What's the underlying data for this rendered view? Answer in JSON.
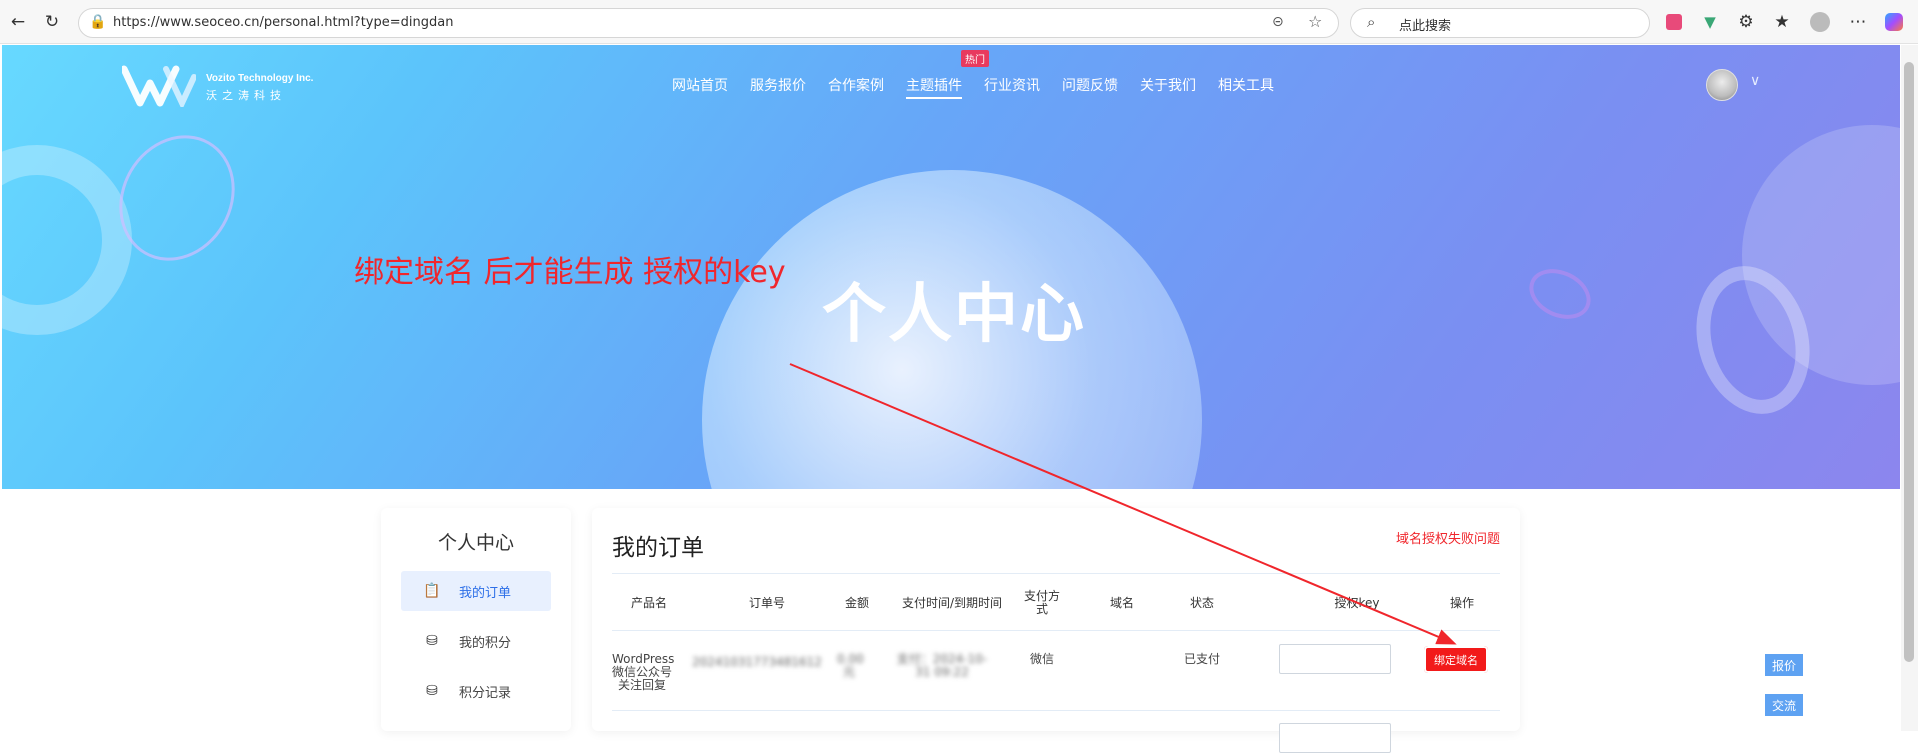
{
  "browser": {
    "url": "https://www.seoceo.cn/personal.html?type=dingdan",
    "search_placeholder": "点此搜索"
  },
  "site": {
    "logo_line1": "Vozito Technology Inc.",
    "logo_line2": "沃之涛科技",
    "nav": [
      {
        "label": "网站首页"
      },
      {
        "label": "服务报价"
      },
      {
        "label": "合作案例"
      },
      {
        "label": "主题插件",
        "active": true
      },
      {
        "label": "行业资讯"
      },
      {
        "label": "问题反馈"
      },
      {
        "label": "关于我们"
      },
      {
        "label": "相关工具"
      }
    ],
    "hot_badge": "热门",
    "hero_title": "个人中心",
    "annotation": "绑定域名  后才能生成 授权的key"
  },
  "sidebar": {
    "title": "个人中心",
    "items": [
      {
        "label": "我的订单",
        "active": true
      },
      {
        "label": "我的积分"
      },
      {
        "label": "积分记录"
      }
    ]
  },
  "orders": {
    "title": "我的订单",
    "help_link": "域名授权失败问题",
    "columns": [
      "产品名",
      "订单号",
      "金额",
      "支付时间/到期时间",
      "支付方式",
      "域名",
      "状态",
      "授权key",
      "操作"
    ],
    "rows": [
      {
        "product": "WordPress微信公众号关注回复",
        "order_no": "20241031773481612",
        "amount": "0.00元",
        "pay_time": "支付：2024-10-31 09:22",
        "pay_method": "微信",
        "domain": "",
        "status": "已支付",
        "action": "绑定域名"
      }
    ]
  },
  "float_buttons": [
    "报价",
    "交流"
  ],
  "colors": {
    "accent_blue": "#2d6fe8",
    "alert_red": "#f21a1a"
  }
}
